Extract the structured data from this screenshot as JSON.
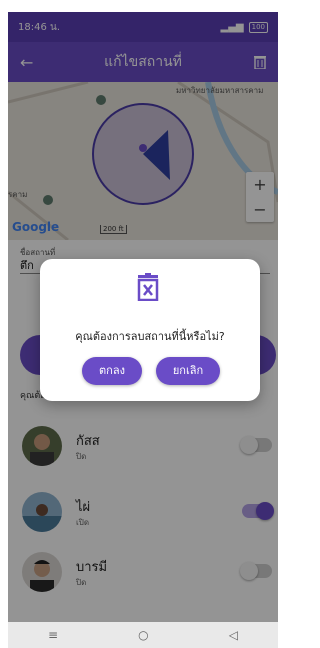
{
  "status_bar": {
    "time": "18:46 น.",
    "battery": "100"
  },
  "app_bar": {
    "back_icon": "arrow-left-icon",
    "title": "แก้ไขสถานที่",
    "delete_icon": "trash-icon"
  },
  "map": {
    "label_top_right": "มหาวิทยาลัยมหาสารคาม",
    "label_left": "รคาม",
    "brand": "Google",
    "scale_text": "200 ft",
    "zoom_in": "+",
    "zoom_out": "−"
  },
  "form": {
    "name_label": "ชื่อสถานที่",
    "name_value": "ตึก",
    "devices_label": "คุณต้องการให้อุปกรณ์เหล่านี้ทำงานอย่างไร",
    "devices": [
      {
        "name": "กัสส",
        "state": "ปิด",
        "on": false
      },
      {
        "name": "ไผ่",
        "state": "เปิด",
        "on": true
      },
      {
        "name": "บารมี",
        "state": "ปิด",
        "on": false
      }
    ]
  },
  "dialog": {
    "icon": "trash-x-icon",
    "message": "คุณต้องการลบสถานที่นี้หรือไม่?",
    "confirm_label": "ตกลง",
    "cancel_label": "ยกเลิก"
  },
  "nav_bar": {
    "menu": "≡",
    "home": "○",
    "back": "◁"
  },
  "colors": {
    "primary": "#6a4cc7",
    "status_bar": "#5b3fb5",
    "toggle_on": "#6a4cc7"
  }
}
